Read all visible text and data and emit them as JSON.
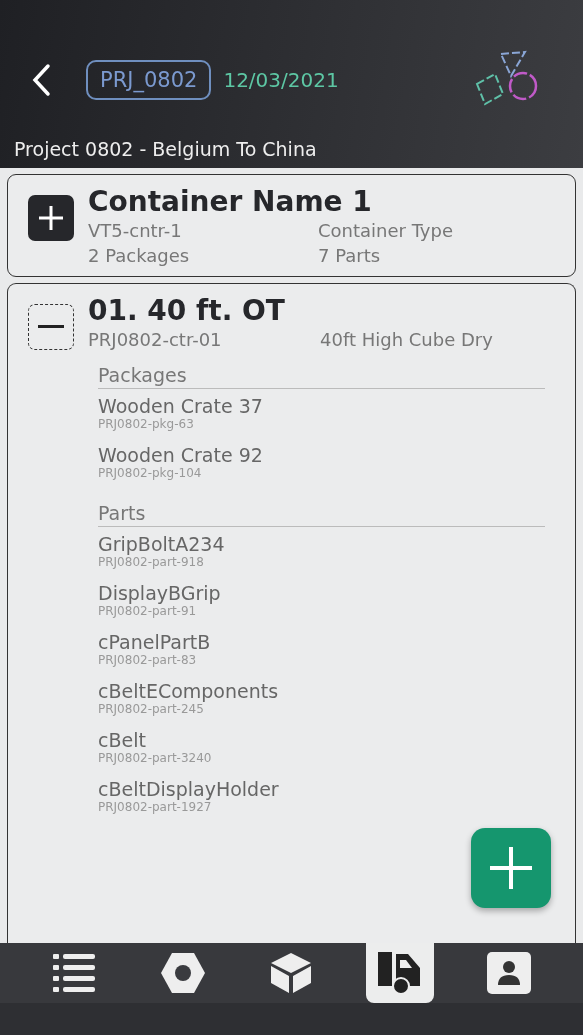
{
  "header": {
    "project_code": "PRJ_0802",
    "date": "12/03/2021",
    "project_title": "Project 0802 - Belgium To China"
  },
  "containers": [
    {
      "name": "Container Name 1",
      "expanded": false,
      "code": "VT5-cntr-1",
      "type": "Container Type",
      "packages_count": "2 Packages",
      "parts_count": "7 Parts"
    },
    {
      "name": "01. 40 ft. OT",
      "expanded": true,
      "code": "PRJ0802-ctr-01",
      "type": "40ft High Cube Dry",
      "sections": [
        {
          "title": "Packages",
          "items": [
            {
              "name": "Wooden Crate 37",
              "code": "PRJ0802-pkg-63"
            },
            {
              "name": "Wooden Crate 92",
              "code": "PRJ0802-pkg-104"
            }
          ]
        },
        {
          "title": "Parts",
          "items": [
            {
              "name": "GripBoltA234",
              "code": "PRJ0802-part-918"
            },
            {
              "name": "DisplayBGrip",
              "code": "PRJ0802-part-91"
            },
            {
              "name": "cPanelPartB",
              "code": "PRJ0802-part-83"
            },
            {
              "name": "cBeltEComponents",
              "code": "PRJ0802-part-245"
            },
            {
              "name": "cBelt",
              "code": "PRJ0802-part-3240"
            },
            {
              "name": "cBeltDisplayHolder",
              "code": "PRJ0802-part-1927"
            }
          ]
        }
      ]
    }
  ],
  "nav": [
    {
      "kind": "list",
      "selected": false
    },
    {
      "kind": "nut",
      "selected": false
    },
    {
      "kind": "box",
      "selected": false
    },
    {
      "kind": "truck",
      "selected": true
    },
    {
      "kind": "contact",
      "selected": false
    }
  ]
}
